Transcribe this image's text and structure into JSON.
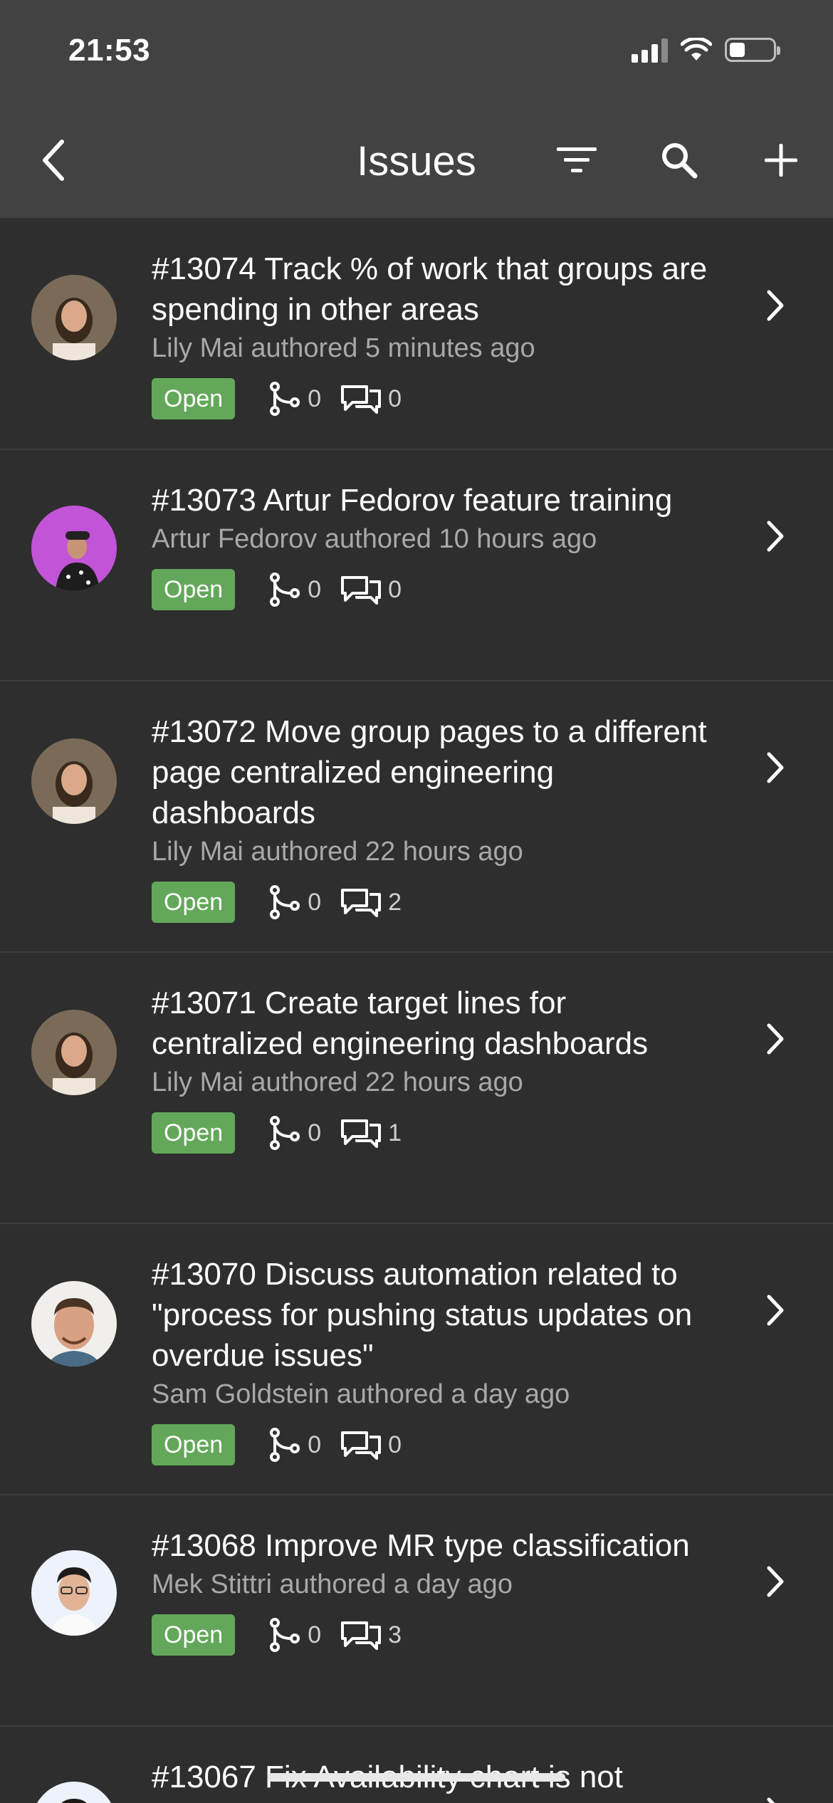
{
  "status_bar": {
    "time": "21:53",
    "battery_level": 0.35
  },
  "nav": {
    "title": "Issues",
    "back_icon": "chevron-left-icon",
    "filter_icon": "filter-icon",
    "search_icon": "search-icon",
    "add_icon": "plus-icon"
  },
  "colors": {
    "background": "#2e2e2e",
    "header": "#424242",
    "badge_open": "#63a85a",
    "meta_text": "#a8a8a8"
  },
  "issues": [
    {
      "title": "#13074 Track % of work that groups are spending in other areas",
      "meta": "Lily Mai authored 5 minutes ago",
      "status": "Open",
      "merge_requests": "0",
      "comments": "0",
      "avatar": "lily-mai"
    },
    {
      "title": "#13073 Artur Fedorov feature training",
      "meta": "Artur Fedorov authored 10 hours ago",
      "status": "Open",
      "merge_requests": "0",
      "comments": "0",
      "avatar": "artur-fedorov"
    },
    {
      "title": "#13072 Move group pages to a different page centralized engineering dashboards",
      "meta": "Lily Mai authored 22 hours ago",
      "status": "Open",
      "merge_requests": "0",
      "comments": "2",
      "avatar": "lily-mai"
    },
    {
      "title": "#13071 Create target lines for centralized engineering dashboards",
      "meta": "Lily Mai authored 22 hours ago",
      "status": "Open",
      "merge_requests": "0",
      "comments": "1",
      "avatar": "lily-mai"
    },
    {
      "title": "#13070 Discuss automation related to \"process for pushing status updates on overdue issues\"",
      "meta": "Sam Goldstein authored a day ago",
      "status": "Open",
      "merge_requests": "0",
      "comments": "0",
      "avatar": "sam-goldstein"
    },
    {
      "title": "#13068 Improve MR type classification",
      "meta": "Mek Stittri authored a day ago",
      "status": "Open",
      "merge_requests": "0",
      "comments": "3",
      "avatar": "mek-stittri"
    },
    {
      "title": "#13067 Fix Availability chart is not",
      "meta": "",
      "status": "",
      "merge_requests": "",
      "comments": "",
      "avatar": "mek-stittri"
    }
  ]
}
